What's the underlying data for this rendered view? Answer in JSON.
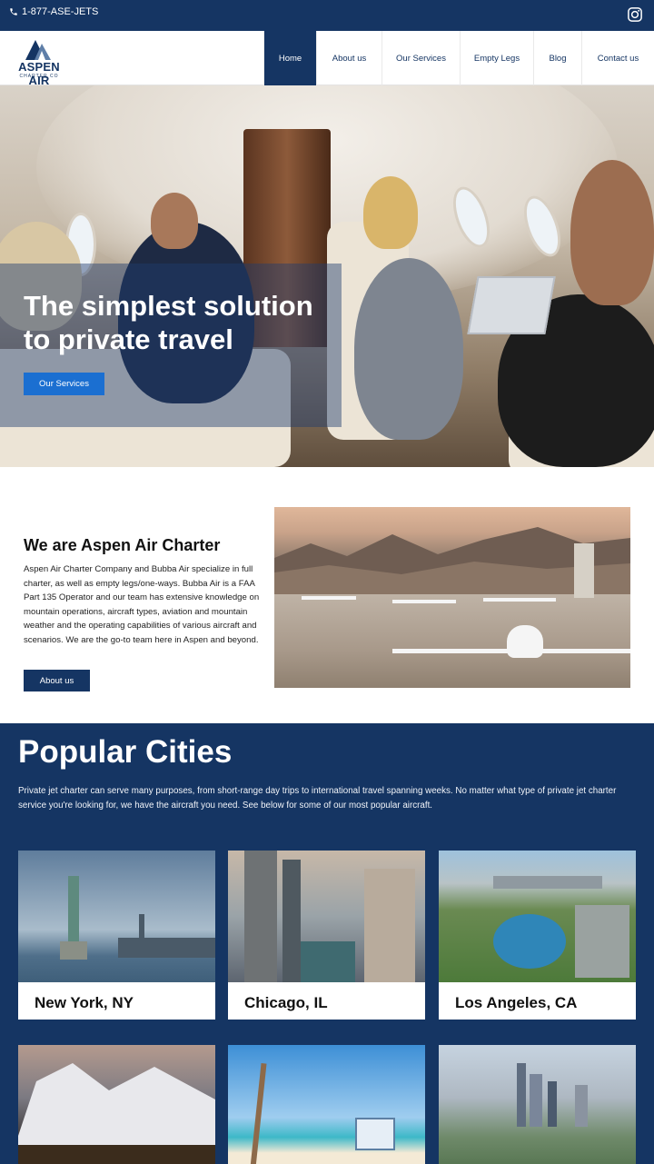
{
  "topbar": {
    "phone": "1-877-ASE-JETS",
    "icons": {
      "phone": "phone-icon",
      "instagram": "instagram-icon"
    }
  },
  "logo": {
    "line1": "ASPEN AIR",
    "line2": "CHARTER CO"
  },
  "nav": {
    "items": [
      "Home",
      "About us",
      "Our Services",
      "Empty Legs",
      "Blog",
      "Contact us"
    ],
    "active": "Home"
  },
  "hero": {
    "title": "The simplest solution to private travel",
    "button": "Our Services"
  },
  "about": {
    "title": "We are Aspen Air Charter",
    "text": "Aspen Air Charter Company and Bubba Air specialize in full charter, as well as empty legs/one-ways. Bubba Air is a FAA Part 135 Operator and our team has extensive knowledge on mountain operations, aircraft types, aviation and mountain weather and the operating capabilities of various aircraft and scenarios. We are the go-to team here in Aspen and beyond.",
    "button": "About us"
  },
  "cities": {
    "title": "Popular Cities",
    "intro": "Private jet charter can serve many purposes, from short-range day trips to international travel spanning weeks. No matter what type of private jet charter service you're looking for, we have the aircraft you need. See below for some of our most popular aircraft.",
    "items": [
      {
        "name": "New York, NY"
      },
      {
        "name": "Chicago, IL"
      },
      {
        "name": "Los Angeles, CA"
      },
      {
        "name": ""
      },
      {
        "name": ""
      },
      {
        "name": ""
      }
    ]
  },
  "colors": {
    "navy": "#153563",
    "accent_blue": "#1b6fd1",
    "white": "#ffffff"
  }
}
